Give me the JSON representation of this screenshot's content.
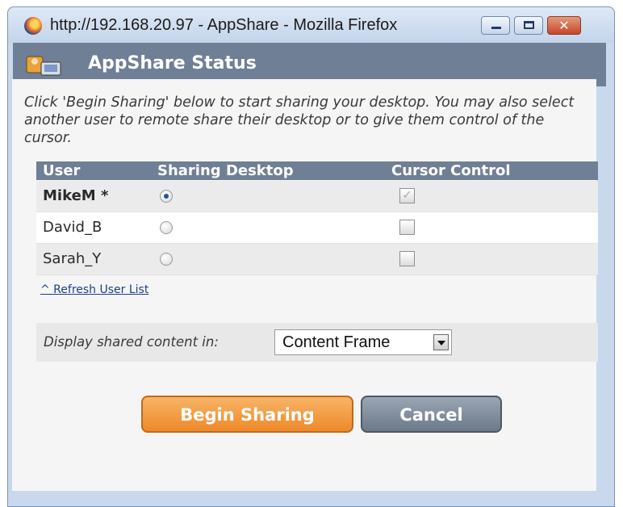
{
  "window": {
    "title": "http://192.168.20.97 - AppShare - Mozilla Firefox",
    "controls": {
      "minimize": "minimize",
      "maximize": "maximize",
      "close": "close"
    }
  },
  "header": {
    "title": "AppShare Status",
    "icon": "users-share-icon"
  },
  "intro": "Click 'Begin Sharing' below to start sharing your desktop. You may also select another user to remote share their desktop or to give them control of the cursor.",
  "table": {
    "columns": [
      "User",
      "Sharing Desktop",
      "Cursor Control"
    ],
    "rows": [
      {
        "user": "MikeM *",
        "sharing": true,
        "cursor": true,
        "cursor_disabled": true
      },
      {
        "user": "David_B",
        "sharing": false,
        "cursor": false
      },
      {
        "user": "Sarah_Y",
        "sharing": false,
        "cursor": false
      }
    ]
  },
  "refresh_link": "^ Refresh User List",
  "display": {
    "label": "Display shared content in:",
    "selected": "Content Frame"
  },
  "buttons": {
    "begin": "Begin Sharing",
    "cancel": "Cancel"
  },
  "colors": {
    "header_bg": "#6f7f95",
    "begin_button": "#f0923a",
    "cancel_button": "#7a8696",
    "link": "#1f3f8a"
  }
}
